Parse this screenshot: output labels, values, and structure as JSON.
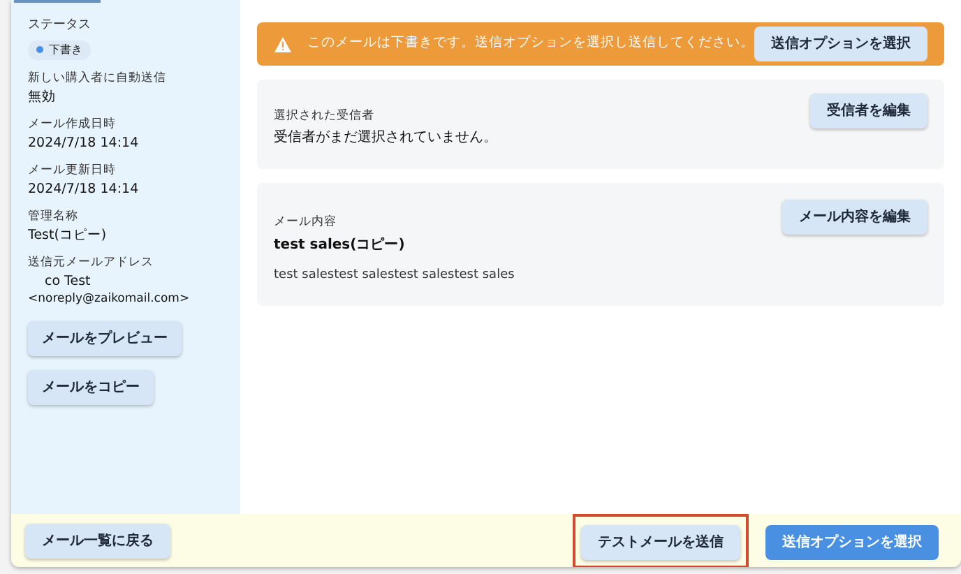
{
  "sidebar": {
    "status": {
      "label": "ステータス",
      "badge": "下書き",
      "color": "#4a90e2"
    },
    "fields": [
      {
        "label": "新しい購入者に自動送信",
        "value": "無効"
      },
      {
        "label": "メール作成日時",
        "value": "2024/7/18 14:14"
      },
      {
        "label": "メール更新日時",
        "value": "2024/7/18 14:14"
      },
      {
        "label": "管理名称",
        "value": "Test(コピー)"
      },
      {
        "label": "送信元メールアドレス",
        "value": "co Test",
        "value_2": "<noreply@zaikomail.com>"
      }
    ],
    "buttons": [
      "メールをプレビュー",
      "メールをコピー"
    ]
  },
  "alert": {
    "message": "このメールは下書きです。送信オプションを選択し送信してください。",
    "button": "送信オプションを選択"
  },
  "recipients": {
    "label": "選択された受信者",
    "value": "受信者がまだ選択されていません。",
    "button": "受信者を編集"
  },
  "content": {
    "label": "メール内容",
    "title": "test sales(コピー)",
    "body": "test salestest salestest salestest sales",
    "button": "メール内容を編集"
  },
  "footer": {
    "back_button": "メール一覧に戻る",
    "buttons": [
      {
        "label": "テストメールを送信",
        "kind": "secondary",
        "highlighted": true
      },
      {
        "label": "送信オプションを選択",
        "kind": "primary",
        "highlighted": false
      }
    ]
  }
}
